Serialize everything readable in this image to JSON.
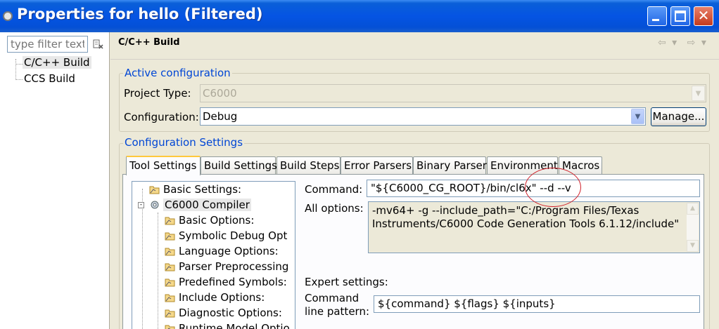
{
  "window": {
    "title": "Properties for hello (Filtered)",
    "close_glyph": "✕"
  },
  "left": {
    "filter_placeholder": "type filter text",
    "items": [
      {
        "label": "C/C++ Build"
      },
      {
        "label": "CCS Build"
      }
    ]
  },
  "page": {
    "title": "C/C++ Build",
    "nav_back": "⇦ ▾",
    "nav_fwd": "⇨ ▾"
  },
  "active_config": {
    "group_label": "Active configuration",
    "project_type_label": "Project Type:",
    "project_type_value": "C6000",
    "configuration_label": "Configuration:",
    "configuration_value": "Debug",
    "manage_label": "Manage..."
  },
  "config_settings": {
    "group_label": "Configuration Settings",
    "tabs": [
      {
        "label": "Tool Settings"
      },
      {
        "label": "Build Settings"
      },
      {
        "label": "Build Steps"
      },
      {
        "label": "Error Parsers"
      },
      {
        "label": "Binary Parser"
      },
      {
        "label": "Environment"
      },
      {
        "label": "Macros"
      }
    ]
  },
  "tool_tree": [
    {
      "label": "Basic Settings:"
    },
    {
      "label": "C6000 Compiler"
    },
    {
      "label": "Basic Options:"
    },
    {
      "label": "Symbolic Debug Opt"
    },
    {
      "label": "Language Options:"
    },
    {
      "label": "Parser Preprocessing"
    },
    {
      "label": "Predefined Symbols:"
    },
    {
      "label": "Include Options:"
    },
    {
      "label": "Diagnostic Options:"
    },
    {
      "label": "Runtime Model Optio"
    }
  ],
  "tool_settings": {
    "command_label": "Command:",
    "command_value": "\"${C6000_CG_ROOT}/bin/cl6x\" --d --v",
    "all_options_label": "All options:",
    "all_options_line1": "-mv64+ -g --include_path=\"C:/Program Files/Texas",
    "all_options_line2": "Instruments/C6000 Code Generation Tools 6.1.12/include\"",
    "expert_label": "Expert settings:",
    "pattern_label_line1": "Command",
    "pattern_label_line2": "line pattern:",
    "pattern_value": "${command} ${flags} ${inputs}"
  },
  "colors": {
    "title_bar": "#0554e3",
    "group_label": "#0046d5",
    "annotation": "#d0202a"
  }
}
